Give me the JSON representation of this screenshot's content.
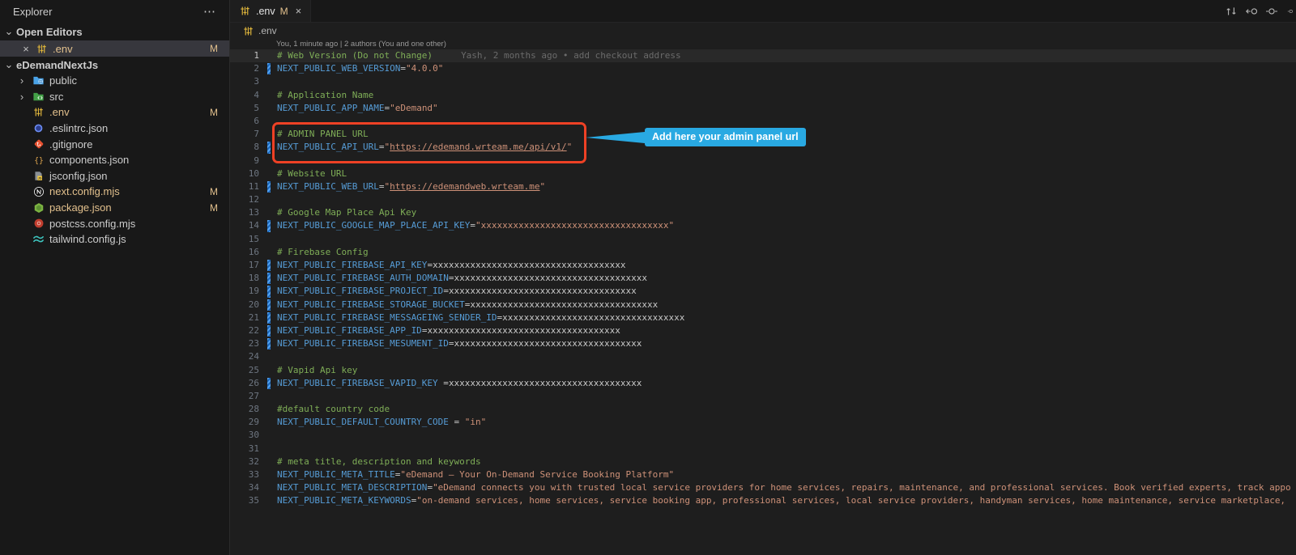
{
  "colors": {
    "accent_red": "#ee4125",
    "callout_blue": "#29a9e2",
    "modified_orange": "#e2c08d"
  },
  "glyphs": {
    "ellipsis": "⋯",
    "chevron_down": "⌄",
    "chevron_right": "›",
    "close": "×"
  },
  "sidebar": {
    "title": "Explorer",
    "open_editors_label": "Open Editors",
    "project_name": "eDemandNextJs",
    "open_editors": [
      {
        "label": ".env",
        "icon": "dotenv",
        "badge": "M",
        "selected": true
      }
    ],
    "tree": [
      {
        "label": "public",
        "icon": "folder-public",
        "folder": true
      },
      {
        "label": "src",
        "icon": "folder-src",
        "folder": true
      },
      {
        "label": ".env",
        "icon": "dotenv",
        "badge": "M"
      },
      {
        "label": ".eslintrc.json",
        "icon": "eslint"
      },
      {
        "label": ".gitignore",
        "icon": "git"
      },
      {
        "label": "components.json",
        "icon": "braces"
      },
      {
        "label": "jsconfig.json",
        "icon": "jsconfig"
      },
      {
        "label": "next.config.mjs",
        "icon": "nextjs",
        "badge": "M"
      },
      {
        "label": "package.json",
        "icon": "node",
        "badge": "M"
      },
      {
        "label": "postcss.config.mjs",
        "icon": "postcss"
      },
      {
        "label": "tailwind.config.js",
        "icon": "tailwind"
      }
    ]
  },
  "tab": {
    "label": ".env",
    "badge": "M",
    "icon": "dotenv"
  },
  "breadcrumb": {
    "label": ".env",
    "icon": "dotenv"
  },
  "editor_actions": [
    "compare-changes-icon",
    "open-previous-change-icon",
    "open-next-change-icon",
    "partial-circle-icon"
  ],
  "editor": {
    "codelens": "You, 1 minute ago | 2 authors (You and one other)",
    "lines": [
      {
        "n": 1,
        "active": true,
        "segs": [
          [
            "c",
            "# Web Version (Do not Change)"
          ],
          [
            "b",
            "Yash, 2 months ago • add checkout address"
          ]
        ]
      },
      {
        "n": 2,
        "chg": true,
        "segs": [
          [
            "k",
            "NEXT_PUBLIC_WEB_VERSION"
          ],
          [
            "p",
            "="
          ],
          [
            "s",
            "\"4.0.0\""
          ]
        ]
      },
      {
        "n": 3,
        "segs": []
      },
      {
        "n": 4,
        "segs": [
          [
            "c",
            "# Application Name"
          ]
        ]
      },
      {
        "n": 5,
        "segs": [
          [
            "k",
            "NEXT_PUBLIC_APP_NAME"
          ],
          [
            "p",
            "="
          ],
          [
            "s",
            "\"eDemand\""
          ]
        ]
      },
      {
        "n": 6,
        "segs": []
      },
      {
        "n": 7,
        "segs": [
          [
            "c",
            "# ADMIN PANEL URL"
          ]
        ]
      },
      {
        "n": 8,
        "chg": true,
        "segs": [
          [
            "k",
            "NEXT_PUBLIC_API_URL"
          ],
          [
            "p",
            "="
          ],
          [
            "s",
            "\""
          ],
          [
            "l",
            "https://edemand.wrteam.me/api/v1/"
          ],
          [
            "s",
            "\""
          ]
        ]
      },
      {
        "n": 9,
        "segs": []
      },
      {
        "n": 10,
        "segs": [
          [
            "c",
            "# Website URL"
          ]
        ]
      },
      {
        "n": 11,
        "chg": true,
        "segs": [
          [
            "k",
            "NEXT_PUBLIC_WEB_URL"
          ],
          [
            "p",
            "="
          ],
          [
            "s",
            "\""
          ],
          [
            "l",
            "https://edemandweb.wrteam.me"
          ],
          [
            "s",
            "\""
          ]
        ]
      },
      {
        "n": 12,
        "segs": []
      },
      {
        "n": 13,
        "segs": [
          [
            "c",
            "# Google Map Place Api Key"
          ]
        ]
      },
      {
        "n": 14,
        "chg": true,
        "segs": [
          [
            "k",
            "NEXT_PUBLIC_GOOGLE_MAP_PLACE_API_KEY"
          ],
          [
            "p",
            "="
          ],
          [
            "s",
            "\"xxxxxxxxxxxxxxxxxxxxxxxxxxxxxxxxxxx\""
          ]
        ]
      },
      {
        "n": 15,
        "segs": []
      },
      {
        "n": 16,
        "segs": [
          [
            "c",
            "# Firebase Config"
          ]
        ]
      },
      {
        "n": 17,
        "chg": true,
        "segs": [
          [
            "k",
            "NEXT_PUBLIC_FIREBASE_API_KEY"
          ],
          [
            "p",
            "="
          ],
          [
            "p",
            "xxxxxxxxxxxxxxxxxxxxxxxxxxxxxxxxxxxx"
          ]
        ]
      },
      {
        "n": 18,
        "chg": true,
        "segs": [
          [
            "k",
            "NEXT_PUBLIC_FIREBASE_AUTH_DOMAIN"
          ],
          [
            "p",
            "="
          ],
          [
            "p",
            "xxxxxxxxxxxxxxxxxxxxxxxxxxxxxxxxxxxx"
          ]
        ]
      },
      {
        "n": 19,
        "chg": true,
        "segs": [
          [
            "k",
            "NEXT_PUBLIC_FIREBASE_PROJECT_ID"
          ],
          [
            "p",
            "="
          ],
          [
            "p",
            "xxxxxxxxxxxxxxxxxxxxxxxxxxxxxxxxxxx"
          ]
        ]
      },
      {
        "n": 20,
        "chg": true,
        "segs": [
          [
            "k",
            "NEXT_PUBLIC_FIREBASE_STORAGE_BUCKET"
          ],
          [
            "p",
            "="
          ],
          [
            "p",
            "xxxxxxxxxxxxxxxxxxxxxxxxxxxxxxxxxxx"
          ]
        ]
      },
      {
        "n": 21,
        "chg": true,
        "segs": [
          [
            "k",
            "NEXT_PUBLIC_FIREBASE_MESSAGEING_SENDER_ID"
          ],
          [
            "p",
            "="
          ],
          [
            "p",
            "xxxxxxxxxxxxxxxxxxxxxxxxxxxxxxxxxx"
          ]
        ]
      },
      {
        "n": 22,
        "chg": true,
        "segs": [
          [
            "k",
            "NEXT_PUBLIC_FIREBASE_APP_ID"
          ],
          [
            "p",
            "="
          ],
          [
            "p",
            "xxxxxxxxxxxxxxxxxxxxxxxxxxxxxxxxxxxx"
          ]
        ]
      },
      {
        "n": 23,
        "chg": true,
        "segs": [
          [
            "k",
            "NEXT_PUBLIC_FIREBASE_MESUMENT_ID"
          ],
          [
            "p",
            "="
          ],
          [
            "p",
            "xxxxxxxxxxxxxxxxxxxxxxxxxxxxxxxxxxx"
          ]
        ]
      },
      {
        "n": 24,
        "segs": []
      },
      {
        "n": 25,
        "segs": [
          [
            "c",
            "# Vapid Api key"
          ]
        ]
      },
      {
        "n": 26,
        "chg": true,
        "segs": [
          [
            "k",
            "NEXT_PUBLIC_FIREBASE_VAPID_KEY"
          ],
          [
            "p",
            " ="
          ],
          [
            "p",
            "xxxxxxxxxxxxxxxxxxxxxxxxxxxxxxxxxxxx"
          ]
        ]
      },
      {
        "n": 27,
        "segs": []
      },
      {
        "n": 28,
        "segs": [
          [
            "c",
            "#default country code"
          ]
        ]
      },
      {
        "n": 29,
        "segs": [
          [
            "k",
            "NEXT_PUBLIC_DEFAULT_COUNTRY_CODE"
          ],
          [
            "p",
            " = "
          ],
          [
            "s",
            "\"in\""
          ]
        ]
      },
      {
        "n": 30,
        "segs": []
      },
      {
        "n": 31,
        "segs": []
      },
      {
        "n": 32,
        "segs": [
          [
            "c",
            "# meta title, description and keywords"
          ]
        ]
      },
      {
        "n": 33,
        "segs": [
          [
            "k",
            "NEXT_PUBLIC_META_TITLE"
          ],
          [
            "p",
            "="
          ],
          [
            "s",
            "\"eDemand – Your On-Demand Service Booking Platform\""
          ]
        ]
      },
      {
        "n": 34,
        "segs": [
          [
            "k",
            "NEXT_PUBLIC_META_DESCRIPTION"
          ],
          [
            "p",
            "="
          ],
          [
            "s",
            "\"eDemand connects you with trusted local service providers for home services, repairs, maintenance, and professional services. Book verified experts, track appo"
          ]
        ]
      },
      {
        "n": 35,
        "segs": [
          [
            "k",
            "NEXT_PUBLIC_META_KEYWORDS"
          ],
          [
            "p",
            "="
          ],
          [
            "s",
            "\"on-demand services, home services, service booking app, professional services, local service providers, handyman services, home maintenance, service marketplace, "
          ]
        ]
      }
    ]
  },
  "annotation": {
    "callout_text": "Add here your admin panel url"
  }
}
